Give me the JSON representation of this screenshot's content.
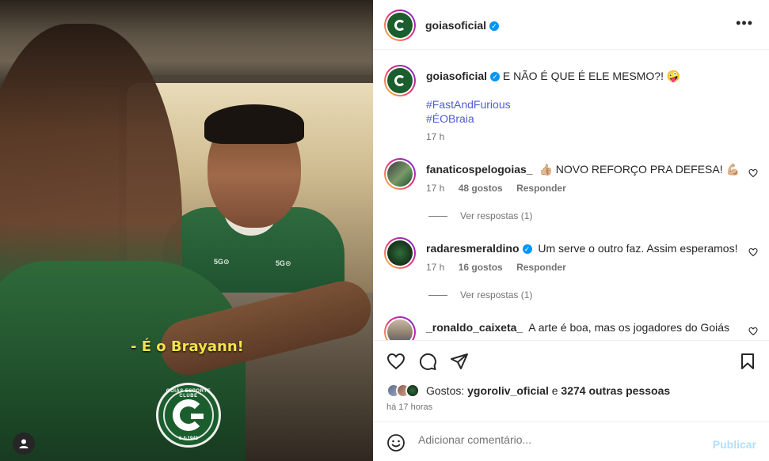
{
  "media": {
    "caption_overlay": "- É o Brayann!",
    "badge_top": "GOIÁS ESPORTE CLUBE",
    "badge_bottom": "6-4-1943",
    "sponsor_1": "5G⊙",
    "sponsor_2": "5G⊙"
  },
  "post": {
    "author": "goiasoficial",
    "verified": true,
    "caption": "E NÃO É QUE É ELE MESMO?! 🤪",
    "hashtags": [
      "#FastAndFurious",
      "#ÉOBraia"
    ],
    "caption_time": "17 h"
  },
  "comments": [
    {
      "user": "fanaticospelogoias_",
      "verified": false,
      "text": "👍🏼 NOVO REFORÇO PRA DEFESA! 💪🏼",
      "time": "17 h",
      "likes": "48 gostos",
      "reply": "Responder",
      "view_replies": "Ver respostas (1)"
    },
    {
      "user": "radaresmeraldino",
      "verified": true,
      "text": "Um serve o outro faz. Assim esperamos!",
      "time": "17 h",
      "likes": "16 gostos",
      "reply": "Responder",
      "view_replies": "Ver respostas (1)"
    },
    {
      "user": "_ronaldo_caixeta_",
      "verified": false,
      "text": "A arte é boa, mas os jogadores do Goiás"
    }
  ],
  "likes_summary": {
    "prefix": "Gostos:",
    "first_user": "ygoroliv_oficial",
    "connector": "e",
    "others": "3274 outras pessoas"
  },
  "time_ago": "há 17 horas",
  "add_comment": {
    "placeholder": "Adicionar comentário...",
    "publish": "Publicar"
  },
  "icons": {
    "more": "more-horizontal-icon",
    "heart": "heart-icon",
    "comment": "comment-icon",
    "share": "share-icon",
    "save": "bookmark-icon",
    "emoji": "emoji-icon",
    "tag": "person-tag-icon"
  },
  "colors": {
    "link_blue": "#4f5bd5",
    "verified_blue": "#0095f6",
    "publish_disabled": "#b2dffc",
    "club_green": "#1b5e2d",
    "caption_yellow": "#f4e44a"
  }
}
